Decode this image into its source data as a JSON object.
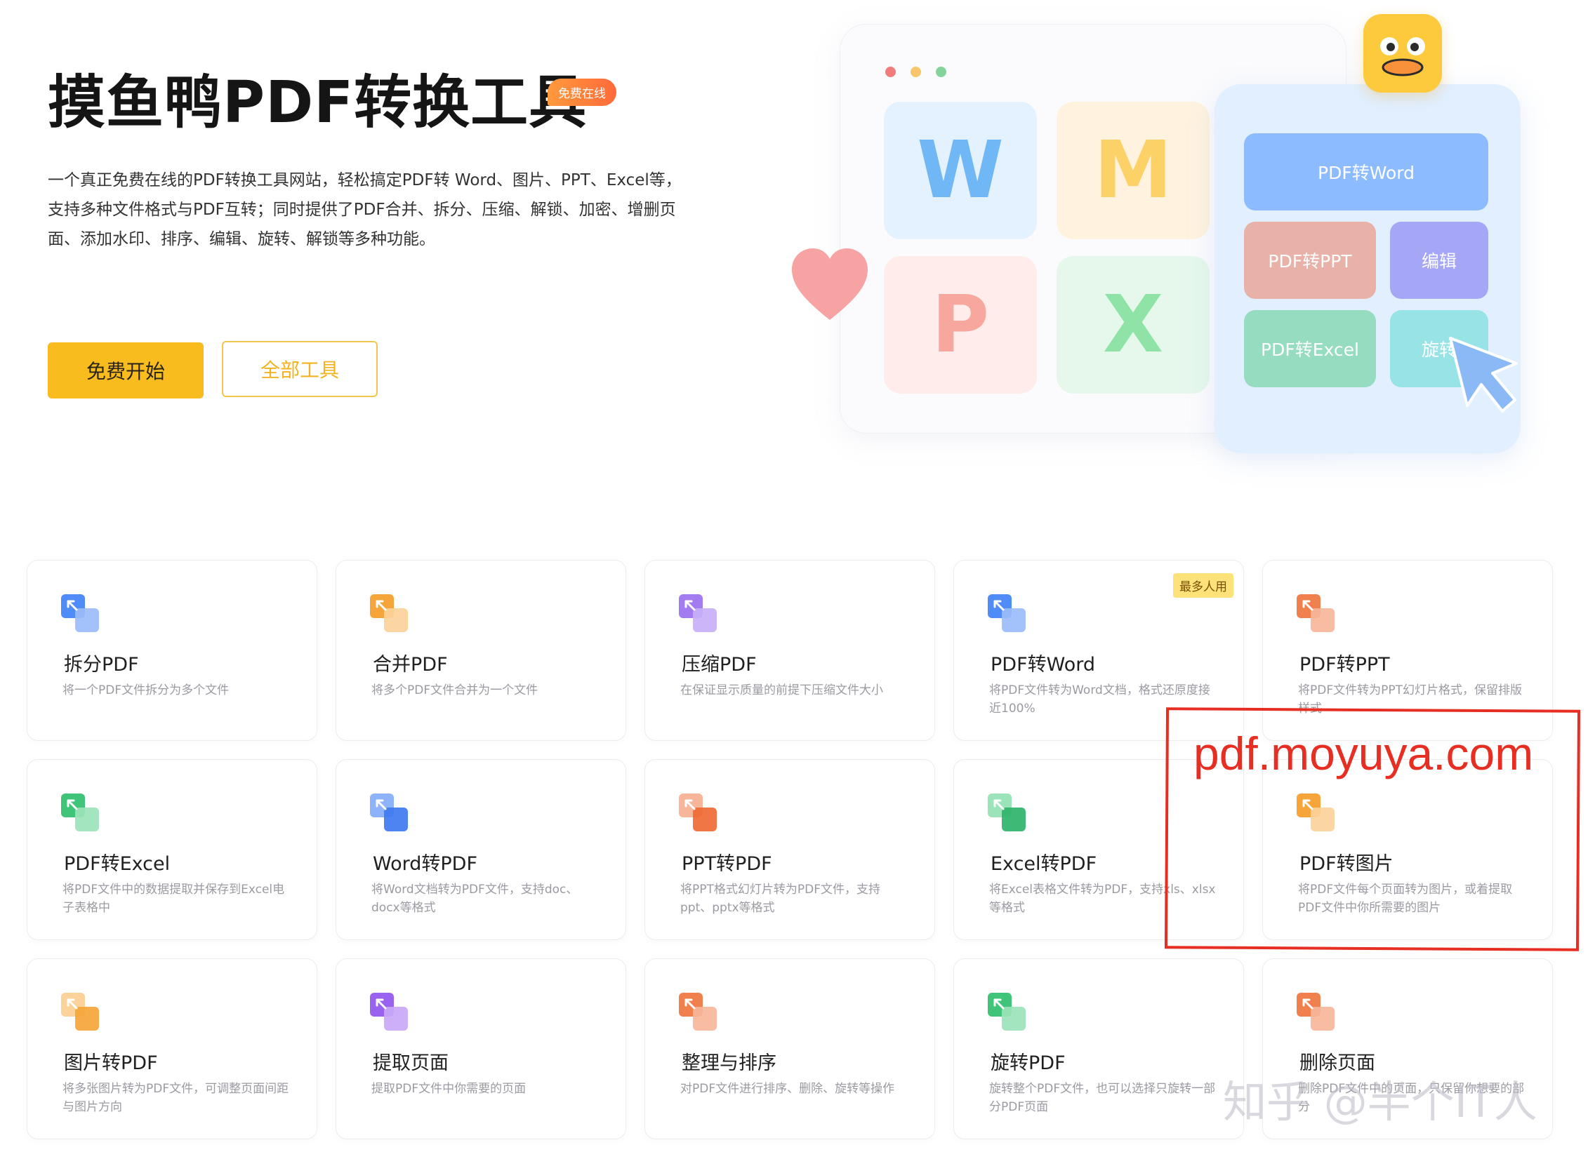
{
  "hero": {
    "title": "摸鱼鸭PDF转换工具",
    "badge": "免费在线",
    "description": "一个真正免费在线的PDF转换工具网站，轻松搞定PDF转 Word、图片、PPT、Excel等，支持多种文件格式与PDF互转；同时提供了PDF合并、拆分、压缩、解锁、加密、增删页面、添加水印、排序、编辑、旋转、解锁等多种功能。",
    "start_button": "免费开始",
    "all_tools_button": "全部工具"
  },
  "illustration": {
    "tile_letters": [
      "W",
      "M",
      "P",
      "X"
    ],
    "panel_buttons": [
      "PDF转Word",
      "PDF转PPT",
      "编辑",
      "PDF转Excel",
      "旋转"
    ]
  },
  "tools": [
    {
      "title": "拆分PDF",
      "desc": "将一个PDF文件拆分为多个文件",
      "icon": "split-icon",
      "badge": ""
    },
    {
      "title": "合并PDF",
      "desc": "将多个PDF文件合并为一个文件",
      "icon": "merge-icon",
      "badge": ""
    },
    {
      "title": "压缩PDF",
      "desc": "在保证显示质量的前提下压缩文件大小",
      "icon": "compress-icon",
      "badge": ""
    },
    {
      "title": "PDF转Word",
      "desc": "将PDF文件转为Word文档，格式还原度接近100%",
      "icon": "pdf-to-word-icon",
      "badge": "最多人用"
    },
    {
      "title": "PDF转PPT",
      "desc": "将PDF文件转为PPT幻灯片格式，保留排版样式",
      "icon": "pdf-to-ppt-icon",
      "badge": ""
    },
    {
      "title": "PDF转Excel",
      "desc": "将PDF文件中的数据提取并保存到Excel电子表格中",
      "icon": "pdf-to-excel-icon",
      "badge": ""
    },
    {
      "title": "Word转PDF",
      "desc": "将Word文档转为PDF文件，支持doc、docx等格式",
      "icon": "word-to-pdf-icon",
      "badge": ""
    },
    {
      "title": "PPT转PDF",
      "desc": "将PPT格式幻灯片转为PDF文件，支持ppt、pptx等格式",
      "icon": "ppt-to-pdf-icon",
      "badge": ""
    },
    {
      "title": "Excel转PDF",
      "desc": "将Excel表格文件转为PDF，支持xls、xlsx等格式",
      "icon": "excel-to-pdf-icon",
      "badge": ""
    },
    {
      "title": "PDF转图片",
      "desc": "将PDF文件每个页面转为图片，或着提取PDF文件中你所需要的图片",
      "icon": "pdf-to-image-icon",
      "badge": ""
    },
    {
      "title": "图片转PDF",
      "desc": "将多张图片转为PDF文件，可调整页面间距与图片方向",
      "icon": "image-to-pdf-icon",
      "badge": ""
    },
    {
      "title": "提取页面",
      "desc": "提取PDF文件中你需要的页面",
      "icon": "extract-pages-icon",
      "badge": ""
    },
    {
      "title": "整理与排序",
      "desc": "对PDF文件进行排序、删除、旋转等操作",
      "icon": "organize-icon",
      "badge": ""
    },
    {
      "title": "旋转PDF",
      "desc": "旋转整个PDF文件，也可以选择只旋转一部分PDF页面",
      "icon": "rotate-icon",
      "badge": ""
    },
    {
      "title": "删除页面",
      "desc": "删除PDF文件中的页面，只保留你想要的部分",
      "icon": "delete-pages-icon",
      "badge": ""
    }
  ],
  "overlay": {
    "url": "pdf.moyuya.com",
    "watermark": "知乎 @半个IT人"
  },
  "colors": {
    "accent_yellow": "#f9bc1f",
    "badge_orange": "#ff7a3a",
    "annotation_red": "#e62e23"
  }
}
